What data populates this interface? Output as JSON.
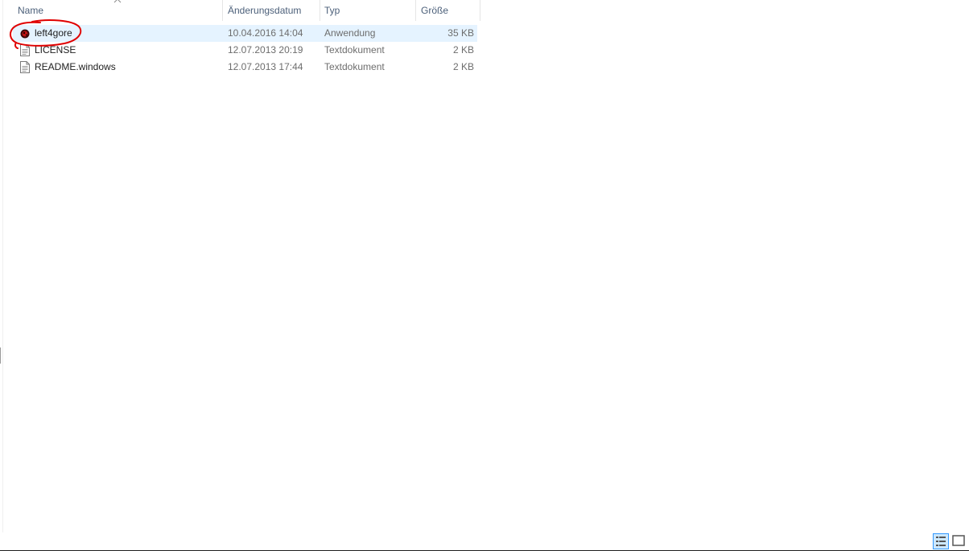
{
  "columns": {
    "name": "Name",
    "date": "Änderungsdatum",
    "type": "Typ",
    "size": "Größe"
  },
  "files": [
    {
      "name": "left4gore",
      "date": "10.04.2016 14:04",
      "type": "Anwendung",
      "size": "35 KB",
      "icon": "application-icon",
      "selected": true
    },
    {
      "name": "LICENSE",
      "date": "12.07.2013 20:19",
      "type": "Textdokument",
      "size": "2 KB",
      "icon": "text-document-icon",
      "selected": false
    },
    {
      "name": "README.windows",
      "date": "12.07.2013 17:44",
      "type": "Textdokument",
      "size": "2 KB",
      "icon": "text-document-icon",
      "selected": false
    }
  ],
  "colors": {
    "selection": "#e5f3ff",
    "annotation": "#e00000",
    "header_text": "#4c607a"
  },
  "status_bar": {
    "view_details": "details-view-icon",
    "view_tiles": "large-icons-view-icon"
  }
}
